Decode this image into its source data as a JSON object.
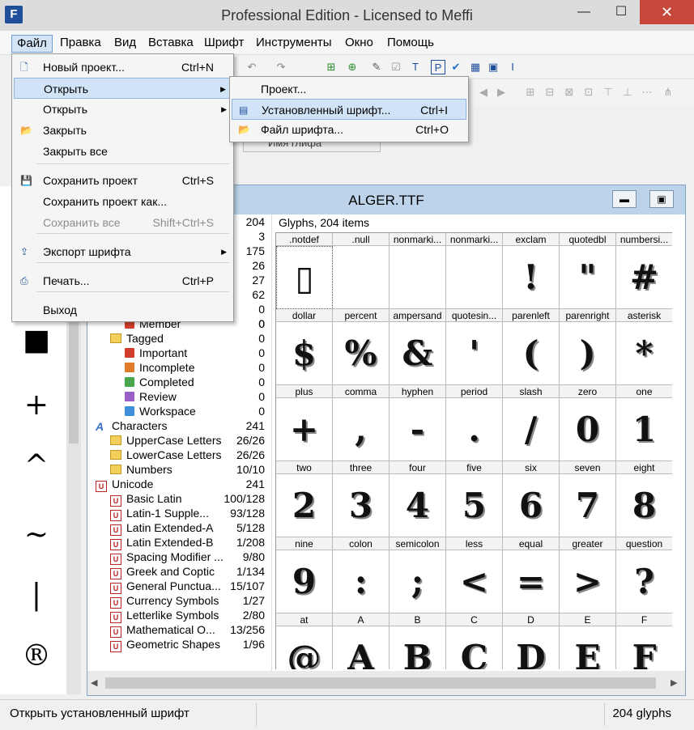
{
  "window": {
    "title": "Professional Edition - Licensed to Meffi",
    "app_icon": "F"
  },
  "menubar": [
    "Файл",
    "Правка",
    "Вид",
    "Вставка",
    "Шрифт",
    "Инструменты",
    "Окно",
    "Помощь"
  ],
  "file_menu": [
    {
      "label": "Новый проект...",
      "shortcut": "Ctrl+N",
      "icon": "new-file-icon"
    },
    {
      "label": "Открыть",
      "shortcut": "",
      "submenu": true,
      "highlighted": true
    },
    {
      "label": "Открыть",
      "shortcut": "",
      "submenu": true
    },
    {
      "label": "Закрыть",
      "shortcut": "",
      "icon": "folder-open-icon"
    },
    {
      "label": "Закрыть все",
      "shortcut": ""
    },
    {
      "label": "Сохранить проект",
      "shortcut": "Ctrl+S",
      "icon": "save-icon"
    },
    {
      "label": "Сохранить проект как...",
      "shortcut": ""
    },
    {
      "label": "Сохранить все",
      "shortcut": "Shift+Ctrl+S",
      "disabled": true
    },
    {
      "label": "Экспорт шрифта",
      "shortcut": "",
      "submenu": true,
      "icon": "export-icon"
    },
    {
      "label": "Печать...",
      "shortcut": "Ctrl+P",
      "icon": "printer-icon"
    },
    {
      "label": "Выход",
      "shortcut": ""
    }
  ],
  "open_submenu": [
    {
      "label": "Проект...",
      "shortcut": ""
    },
    {
      "label": "Установленный шрифт...",
      "shortcut": "Ctrl+I",
      "highlighted": true
    },
    {
      "label": "Файл шрифта...",
      "shortcut": "Ctrl+O"
    }
  ],
  "hidden_column_label": "Имя глифа",
  "child_window": {
    "title": "ALGER.TTF"
  },
  "tree_counts_top": [
    "204",
    "3",
    "175",
    "26",
    "27",
    "62",
    "0",
    "0"
  ],
  "tree": [
    {
      "label": "Member",
      "count": "0",
      "indent": 2,
      "icon": "flag"
    },
    {
      "label": "Tagged",
      "count": "0",
      "indent": 1,
      "icon": "folder"
    },
    {
      "label": "Important",
      "count": "0",
      "indent": 2,
      "icon": "flag",
      "color": "#d23c2b"
    },
    {
      "label": "Incomplete",
      "count": "0",
      "indent": 2,
      "icon": "flag",
      "color": "#e07b2a"
    },
    {
      "label": "Completed",
      "count": "0",
      "indent": 2,
      "icon": "flag",
      "color": "#4aa64a"
    },
    {
      "label": "Review",
      "count": "0",
      "indent": 2,
      "icon": "flag",
      "color": "#9a5ec9"
    },
    {
      "label": "Workspace",
      "count": "0",
      "indent": 2,
      "icon": "flag",
      "color": "#3e8ed8"
    },
    {
      "label": "Characters",
      "count": "241",
      "indent": 0,
      "icon": "char"
    },
    {
      "label": "UpperCase Letters",
      "count": "26/26",
      "indent": 1,
      "icon": "folder"
    },
    {
      "label": "LowerCase Letters",
      "count": "26/26",
      "indent": 1,
      "icon": "folder"
    },
    {
      "label": "Numbers",
      "count": "10/10",
      "indent": 1,
      "icon": "folder"
    },
    {
      "label": "Unicode",
      "count": "241",
      "indent": 0,
      "icon": "uni"
    },
    {
      "label": "Basic Latin",
      "count": "100/128",
      "indent": 1,
      "icon": "uni"
    },
    {
      "label": "Latin-1 Supple...",
      "count": "93/128",
      "indent": 1,
      "icon": "uni"
    },
    {
      "label": "Latin Extended-A",
      "count": "5/128",
      "indent": 1,
      "icon": "uni"
    },
    {
      "label": "Latin Extended-B",
      "count": "1/208",
      "indent": 1,
      "icon": "uni"
    },
    {
      "label": "Spacing Modifier ...",
      "count": "9/80",
      "indent": 1,
      "icon": "uni"
    },
    {
      "label": "Greek and Coptic",
      "count": "1/134",
      "indent": 1,
      "icon": "uni"
    },
    {
      "label": "General Punctua...",
      "count": "15/107",
      "indent": 1,
      "icon": "uni"
    },
    {
      "label": "Currency Symbols",
      "count": "1/27",
      "indent": 1,
      "icon": "uni"
    },
    {
      "label": "Letterlike Symbols",
      "count": "2/80",
      "indent": 1,
      "icon": "uni"
    },
    {
      "label": "Mathematical O...",
      "count": "13/256",
      "indent": 1,
      "icon": "uni"
    },
    {
      "label": "Geometric Shapes",
      "count": "1/96",
      "indent": 1,
      "icon": "uni"
    }
  ],
  "glyph_header": "Glyphs, 204 items",
  "glyph_rows": [
    [
      {
        "n": ".notdef",
        "g": "▯"
      },
      {
        "n": ".null",
        "g": ""
      },
      {
        "n": "nonmarki...",
        "g": ""
      },
      {
        "n": "nonmarki...",
        "g": ""
      },
      {
        "n": "exclam",
        "g": "!"
      },
      {
        "n": "quotedbl",
        "g": "\""
      },
      {
        "n": "numbersi...",
        "g": "#"
      }
    ],
    [
      {
        "n": "dollar",
        "g": "$"
      },
      {
        "n": "percent",
        "g": "%"
      },
      {
        "n": "ampersand",
        "g": "&"
      },
      {
        "n": "quotesin...",
        "g": "'"
      },
      {
        "n": "parenleft",
        "g": "("
      },
      {
        "n": "parenright",
        "g": ")"
      },
      {
        "n": "asterisk",
        "g": "*"
      }
    ],
    [
      {
        "n": "plus",
        "g": "+"
      },
      {
        "n": "comma",
        "g": ","
      },
      {
        "n": "hyphen",
        "g": "-"
      },
      {
        "n": "period",
        "g": "."
      },
      {
        "n": "slash",
        "g": "/"
      },
      {
        "n": "zero",
        "g": "0"
      },
      {
        "n": "one",
        "g": "1"
      }
    ],
    [
      {
        "n": "two",
        "g": "2"
      },
      {
        "n": "three",
        "g": "3"
      },
      {
        "n": "four",
        "g": "4"
      },
      {
        "n": "five",
        "g": "5"
      },
      {
        "n": "six",
        "g": "6"
      },
      {
        "n": "seven",
        "g": "7"
      },
      {
        "n": "eight",
        "g": "8"
      }
    ],
    [
      {
        "n": "nine",
        "g": "9"
      },
      {
        "n": "colon",
        "g": ":"
      },
      {
        "n": "semicolon",
        "g": ";"
      },
      {
        "n": "less",
        "g": "<"
      },
      {
        "n": "equal",
        "g": "="
      },
      {
        "n": "greater",
        "g": ">"
      },
      {
        "n": "question",
        "g": "?"
      }
    ],
    [
      {
        "n": "at",
        "g": "@"
      },
      {
        "n": "A",
        "g": "A"
      },
      {
        "n": "B",
        "g": "B"
      },
      {
        "n": "C",
        "g": "C"
      },
      {
        "n": "D",
        "g": "D"
      },
      {
        "n": "E",
        "g": "E"
      },
      {
        "n": "F",
        "g": "F"
      }
    ]
  ],
  "left_symbols": [
    "■",
    "+",
    "^",
    "~",
    "|",
    "®"
  ],
  "status": {
    "left": "Открыть установленный шрифт",
    "right": "204 glyphs"
  }
}
